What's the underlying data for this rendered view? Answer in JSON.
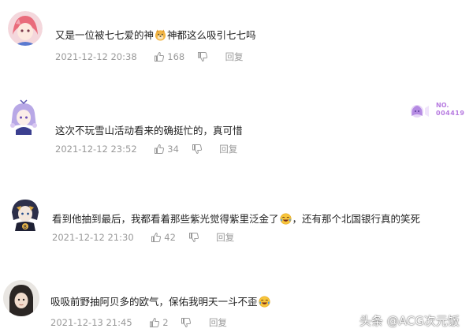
{
  "comments": [
    {
      "text_before": "又是一位被七七爱的神",
      "emoji": "doge-emoji",
      "text_after": "神都这么吸引七七吗",
      "time": "2021-12-12 20:38",
      "likes": "168",
      "reply_label": "回复"
    },
    {
      "text_before": "这次不玩雪山活动看来的确挺忙的，真可惜",
      "time": "2021-12-12 23:52",
      "likes": "34",
      "reply_label": "回复",
      "badge_top": "NO.",
      "badge_num": "004419"
    },
    {
      "text_before": "看到他抽到最后，我都看着那些紫光觉得紫里泛金了",
      "emoji": "laugh-cry-emoji",
      "text_after": "，还有那个北国银行真的笑死",
      "time": "2021-12-12 21:30",
      "likes": "42",
      "reply_label": "回复"
    },
    {
      "text_before": "吸吸前野抽阿贝多的欧气，保佑我明天一斗不歪",
      "emoji": "laugh-cry-emoji",
      "time": "2021-12-13 21:45",
      "likes": "2",
      "reply_label": "回复"
    }
  ],
  "watermark": "头条 @ACG次元饭",
  "colors": {
    "meta": "#999999",
    "text": "#222222",
    "badge_purple": "#b77be0"
  }
}
